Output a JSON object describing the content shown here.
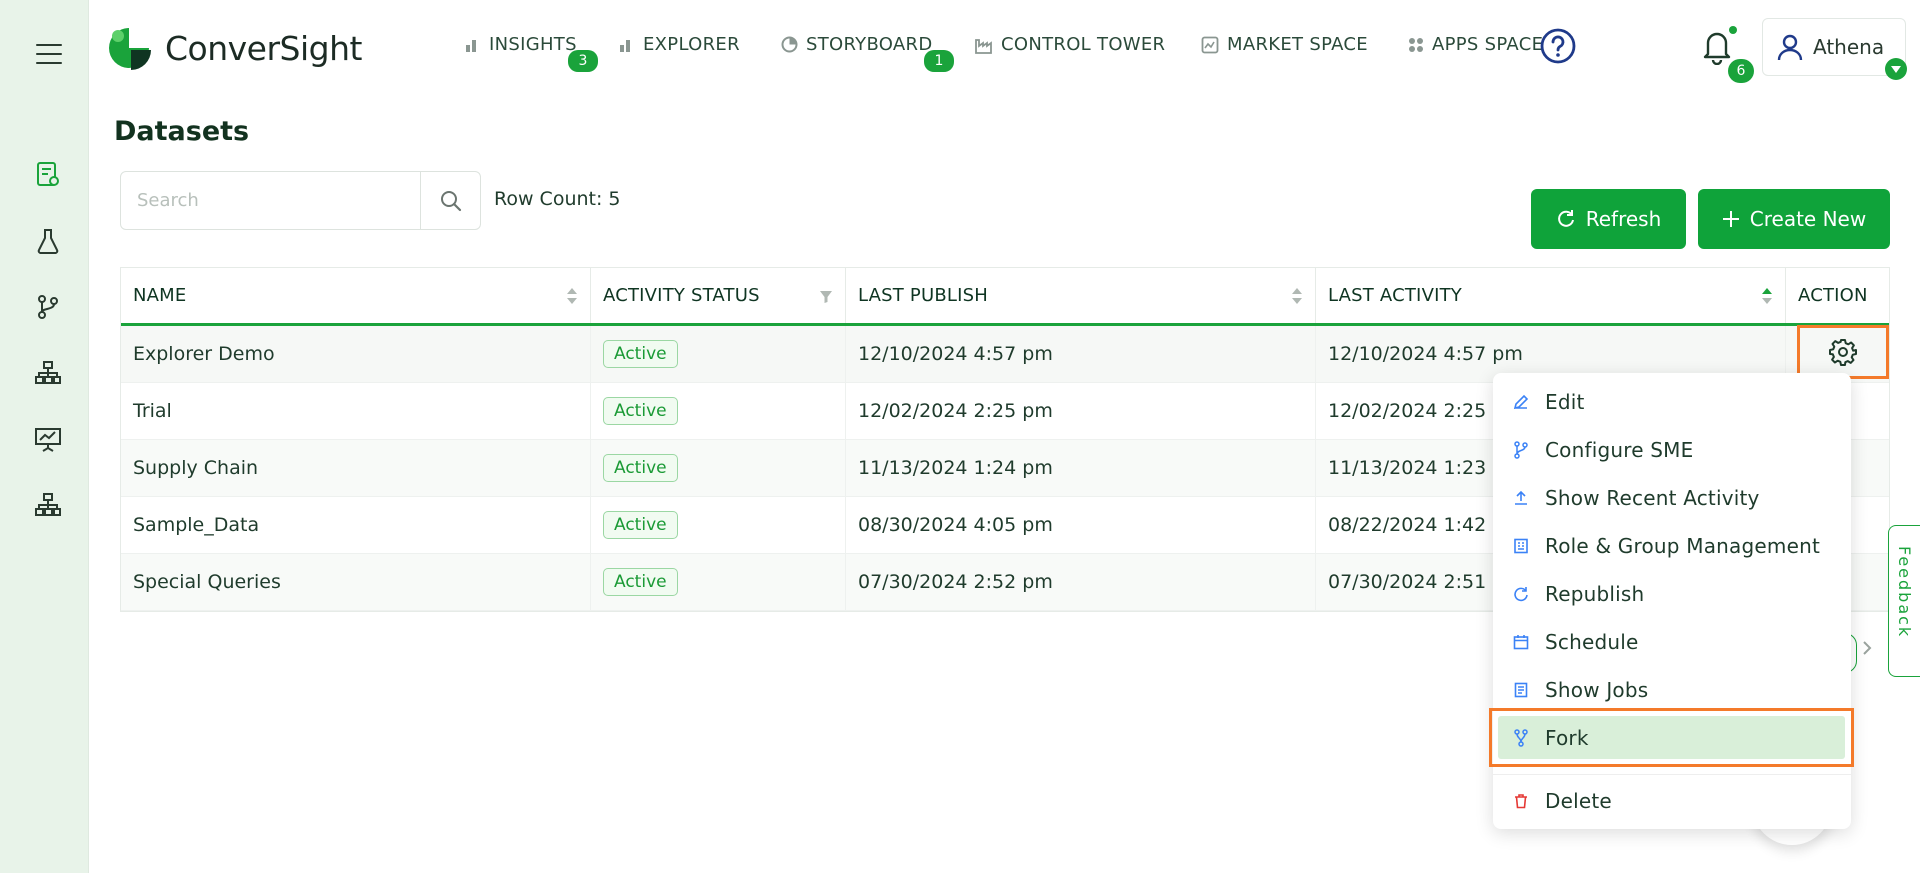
{
  "brand": {
    "name": "ConverSight"
  },
  "nav": [
    {
      "label": "INSIGHTS",
      "icon": "bar-chart-icon",
      "badge": "3"
    },
    {
      "label": "EXPLORER",
      "icon": "bar-chart-icon",
      "badge": ""
    },
    {
      "label": "STORYBOARD",
      "icon": "pie-icon",
      "badge": "1"
    },
    {
      "label": "CONTROL TOWER",
      "icon": "factory-icon",
      "badge": ""
    },
    {
      "label": "MARKET SPACE",
      "icon": "market-icon",
      "badge": ""
    },
    {
      "label": "APPS SPACE",
      "icon": "grid-icon",
      "badge": ""
    }
  ],
  "header": {
    "notifications_count": "6",
    "user_name": "Athena"
  },
  "page": {
    "title": "Datasets",
    "search_placeholder": "Search",
    "row_count": "Row Count: 5",
    "refresh_label": "Refresh",
    "create_label": "Create New"
  },
  "table": {
    "columns": [
      "NAME",
      "ACTIVITY STATUS",
      "LAST PUBLISH",
      "LAST ACTIVITY",
      "ACTION"
    ],
    "rows": [
      {
        "name": "Explorer Demo",
        "status": "Active",
        "last_publish": "12/10/2024 4:57 pm",
        "last_activity": "12/10/2024 4:57 pm"
      },
      {
        "name": "Trial",
        "status": "Active",
        "last_publish": "12/02/2024 2:25 pm",
        "last_activity": "12/02/2024 2:25 pm"
      },
      {
        "name": "Supply Chain",
        "status": "Active",
        "last_publish": "11/13/2024 1:24 pm",
        "last_activity": "11/13/2024 1:23 pm"
      },
      {
        "name": "Sample_Data",
        "status": "Active",
        "last_publish": "08/30/2024 4:05 pm",
        "last_activity": "08/22/2024 1:42 pm"
      },
      {
        "name": "Special Queries",
        "status": "Active",
        "last_publish": "07/30/2024 2:52 pm",
        "last_activity": "07/30/2024 2:51 pm"
      }
    ]
  },
  "action_menu": {
    "items": [
      {
        "label": "Edit",
        "icon": "pencil-icon"
      },
      {
        "label": "Configure SME",
        "icon": "branch-icon"
      },
      {
        "label": "Show Recent Activity",
        "icon": "upload-icon"
      },
      {
        "label": "Role & Group Management",
        "icon": "building-icon"
      },
      {
        "label": "Republish",
        "icon": "refresh-icon"
      },
      {
        "label": "Schedule",
        "icon": "calendar-icon"
      },
      {
        "label": "Show Jobs",
        "icon": "jobs-icon"
      },
      {
        "label": "Fork",
        "icon": "fork-icon"
      },
      {
        "label": "Delete",
        "icon": "trash-icon"
      }
    ]
  },
  "feedback_label": "Feedback",
  "colors": {
    "brand_green": "#0fa33a",
    "highlight_orange": "#f47a2a",
    "sidebar_bg": "#e8f3e9",
    "delete_red": "#e53935",
    "menu_icon_blue": "#3b82f6"
  }
}
